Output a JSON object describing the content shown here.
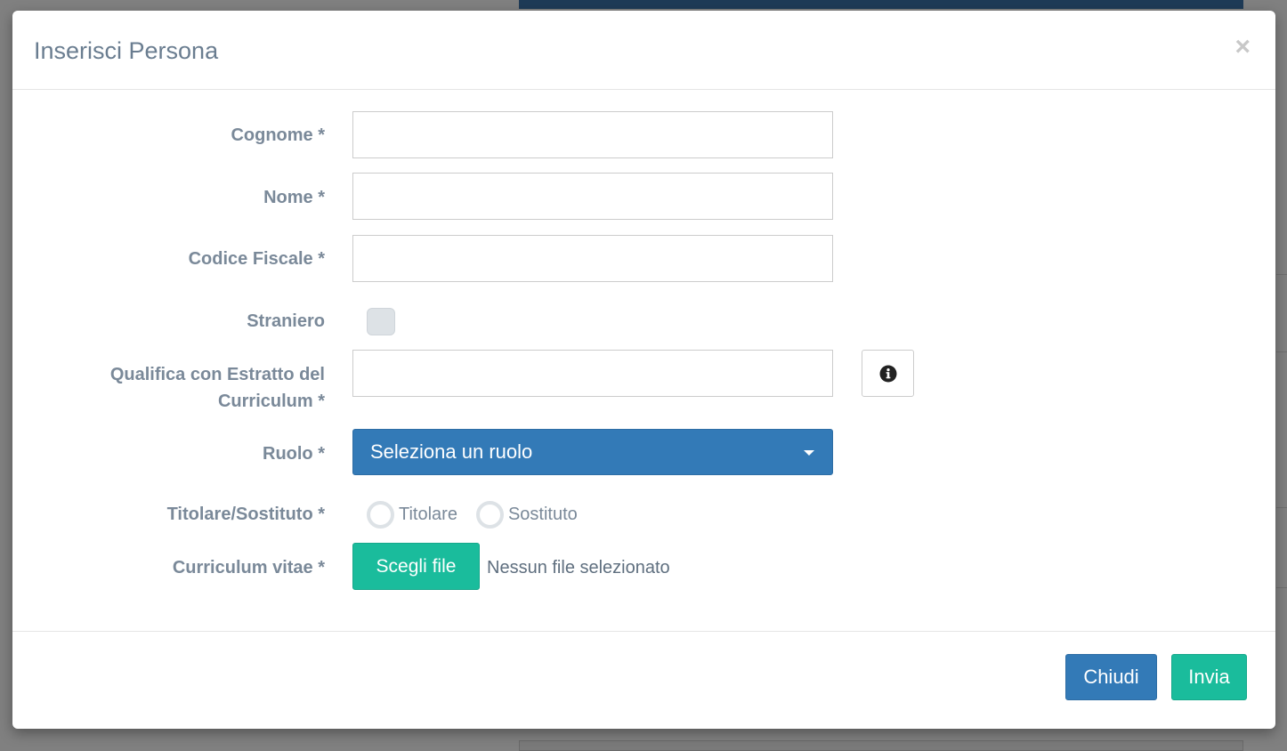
{
  "modal": {
    "title": "Inserisci Persona",
    "close_symbol": "×"
  },
  "form": {
    "cognome": {
      "label": "Cognome *",
      "value": "",
      "placeholder": ""
    },
    "nome": {
      "label": "Nome *",
      "value": "",
      "placeholder": ""
    },
    "codice_fiscale": {
      "label": "Codice Fiscale *",
      "value": "",
      "placeholder": ""
    },
    "straniero": {
      "label": "Straniero",
      "checked": false
    },
    "qualifica": {
      "label_line1": "Qualifica con Estratto del",
      "label_line2": "Curriculum *",
      "value": "",
      "info_icon": "info-circle-icon"
    },
    "ruolo": {
      "label": "Ruolo *",
      "selected": "Seleziona un ruolo"
    },
    "titolare_sostituto": {
      "label": "Titolare/Sostituto *",
      "options": [
        "Titolare",
        "Sostituto"
      ],
      "selected": null
    },
    "curriculum": {
      "label": "Curriculum vitae *",
      "button_label": "Scegli file",
      "status": "Nessun file selezionato"
    }
  },
  "footer": {
    "close_label": "Chiudi",
    "submit_label": "Invia"
  },
  "colors": {
    "primary": "#337ab7",
    "success": "#1abc9c",
    "label": "#7a8999"
  }
}
